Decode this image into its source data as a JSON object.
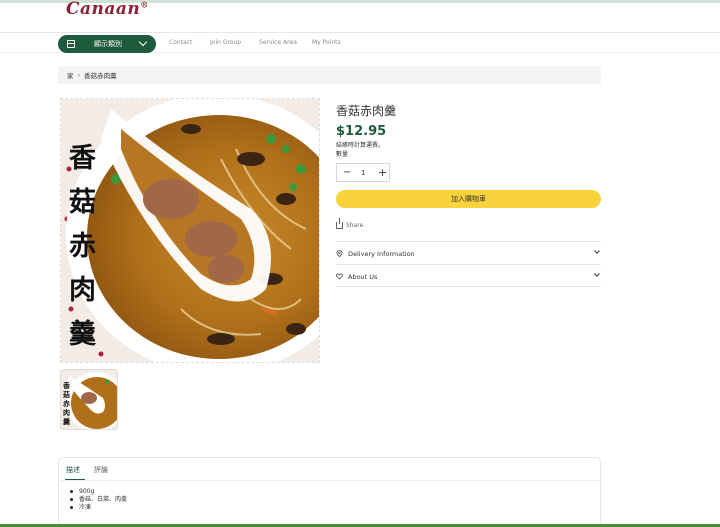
{
  "brand": {
    "logo_text": "Canaan",
    "registered_mark": "®"
  },
  "nav": {
    "categories_label": "顯示類別",
    "links": [
      "Contact",
      "Join Group",
      "Service Area",
      "My Points"
    ]
  },
  "breadcrumb": {
    "home": "家",
    "current": "香菇赤肉羹"
  },
  "product": {
    "image_caption": "香菇赤肉羹",
    "title": "香菇赤肉羹",
    "price": "$12.95",
    "tax_note": "結帳時計算運費。",
    "quantity_label": "數量",
    "quantity_value": "1",
    "minus": "−",
    "plus": "+",
    "add_to_cart": "加入購物車",
    "share": "Share",
    "accordions": [
      "Delivery Information",
      "About Us"
    ]
  },
  "tabs": {
    "items": [
      "描述",
      "評論"
    ],
    "description_items": [
      "900g",
      "香菇、白菜、肉羹",
      "冷凍"
    ]
  },
  "colors": {
    "brand_green": "#1e5a3c",
    "cart_yellow": "#f8d33c",
    "logo_red": "#8e1f3a"
  }
}
